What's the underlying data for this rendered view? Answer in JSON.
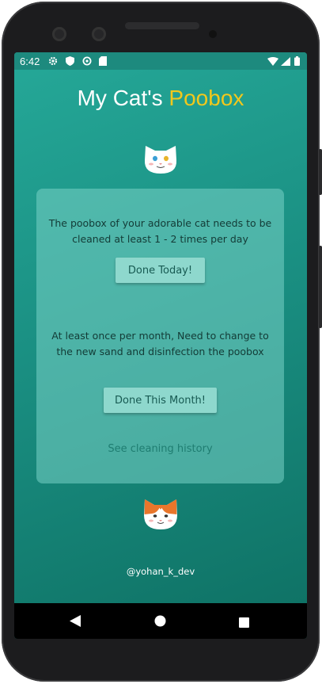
{
  "status_bar": {
    "time": "6:42",
    "left_icons": [
      "gear-icon",
      "shield-icon",
      "sync-icon",
      "sd-card-icon"
    ],
    "right_icons": [
      "wifi-icon",
      "signal-icon",
      "battery-icon"
    ]
  },
  "header": {
    "title_part1": "My Cat's",
    "title_part2": "Poobox",
    "accent_color": "#f2c81c"
  },
  "card": {
    "daily_text": "The poobox of your adorable cat needs to be cleaned at least 1 - 2 times per day",
    "daily_button": "Done Today!",
    "monthly_text": "At least once per month, Need to change to the new sand and disinfection the poobox",
    "monthly_button": "Done This Month!",
    "history_link": "See cleaning history"
  },
  "footer": {
    "credit": "@yohan_k_dev"
  },
  "nav": {
    "buttons": [
      "back-icon",
      "home-icon",
      "recents-icon"
    ]
  },
  "colors": {
    "background_top": "#25a898",
    "background_bottom": "#0e7063",
    "card": "#78d2c6",
    "button": "#8ed8cd",
    "link": "#1f7d71"
  }
}
